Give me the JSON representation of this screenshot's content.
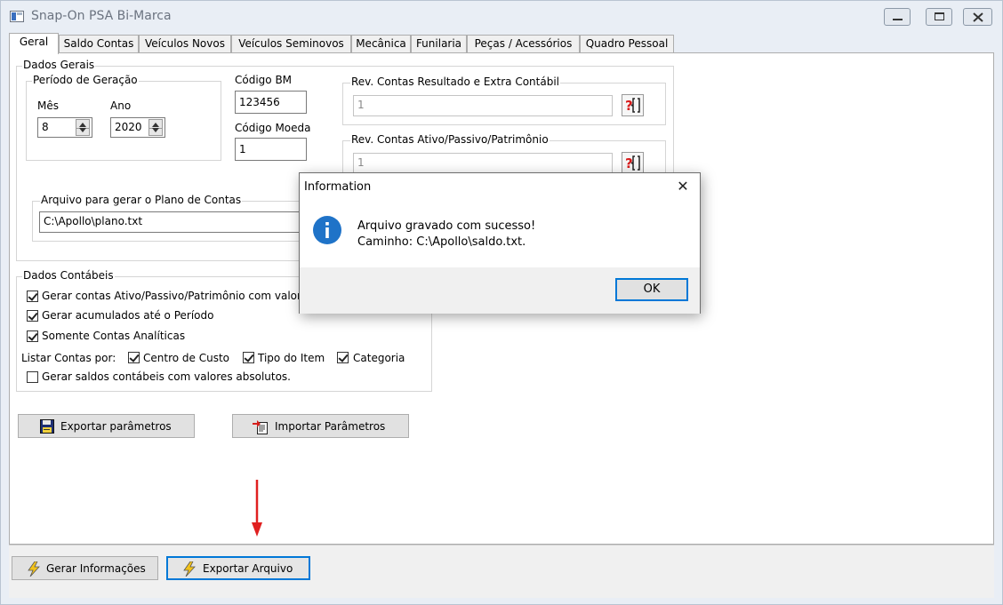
{
  "window": {
    "title": "Snap-On PSA Bi-Marca",
    "controls": [
      "minimize",
      "restore",
      "close"
    ]
  },
  "tabs": [
    {
      "label": "Geral",
      "active": true
    },
    {
      "label": "Saldo Contas"
    },
    {
      "label": "Veículos Novos"
    },
    {
      "label": "Veículos Seminovos"
    },
    {
      "label": "Mecânica"
    },
    {
      "label": "Funilaria"
    },
    {
      "label": "Peças / Acessórios"
    },
    {
      "label": "Quadro Pessoal"
    }
  ],
  "dados_gerais": {
    "legend": "Dados Gerais",
    "periodo": {
      "legend": "Período de Geração",
      "mes_label": "Mês",
      "mes_value": "8",
      "ano_label": "Ano",
      "ano_value": "2020"
    },
    "codigo_bm_label": "Código BM",
    "codigo_bm_value": "123456",
    "codigo_moeda_label": "Código Moeda",
    "codigo_moeda_value": "1",
    "rev_resultado": {
      "legend": "Rev. Contas Resultado e Extra Contábil",
      "value": "1"
    },
    "rev_ativo": {
      "legend": "Rev. Contas Ativo/Passivo/Patrimônio",
      "value": "1"
    },
    "arquivo_plano": {
      "legend": "Arquivo para gerar o Plano de Contas",
      "value": "C:\\Apollo\\plano.txt"
    }
  },
  "dados_contabeis": {
    "legend": "Dados Contábeis",
    "opt_ativo_label": "Gerar contas Ativo/Passivo/Patrimônio com valore",
    "opt_ativo_checked": true,
    "opt_acumulados_label": "Gerar acumulados até o Período",
    "opt_acumulados_checked": true,
    "opt_analiticas_label": "Somente Contas Analíticas",
    "opt_analiticas_checked": true,
    "listar_label": "Listar Contas por:",
    "centro_custo_label": "Centro de Custo",
    "centro_custo_checked": true,
    "tipo_item_label": "Tipo do Item",
    "tipo_item_checked": true,
    "categoria_label": "Categoria",
    "categoria_checked": true,
    "opt_absolutos_label": "Gerar saldos contábeis com valores absolutos.",
    "opt_absolutos_checked": false
  },
  "buttons": {
    "exportar_parametros": "Exportar parâmetros",
    "importar_parametros": "Importar Parâmetros",
    "gerar_informacoes": "Gerar Informações",
    "exportar_arquivo": "Exportar Arquivo"
  },
  "dialog": {
    "title": "Information",
    "line1": "Arquivo gravado com sucesso!",
    "line2": "Caminho: C:\\Apollo\\saldo.txt.",
    "ok": "OK",
    "close_glyph": "✕"
  },
  "colors": {
    "info_icon": "#1f73c8",
    "arrow": "#e02020",
    "lightning": "#f2c21a",
    "focus_border": "#0078d7"
  }
}
